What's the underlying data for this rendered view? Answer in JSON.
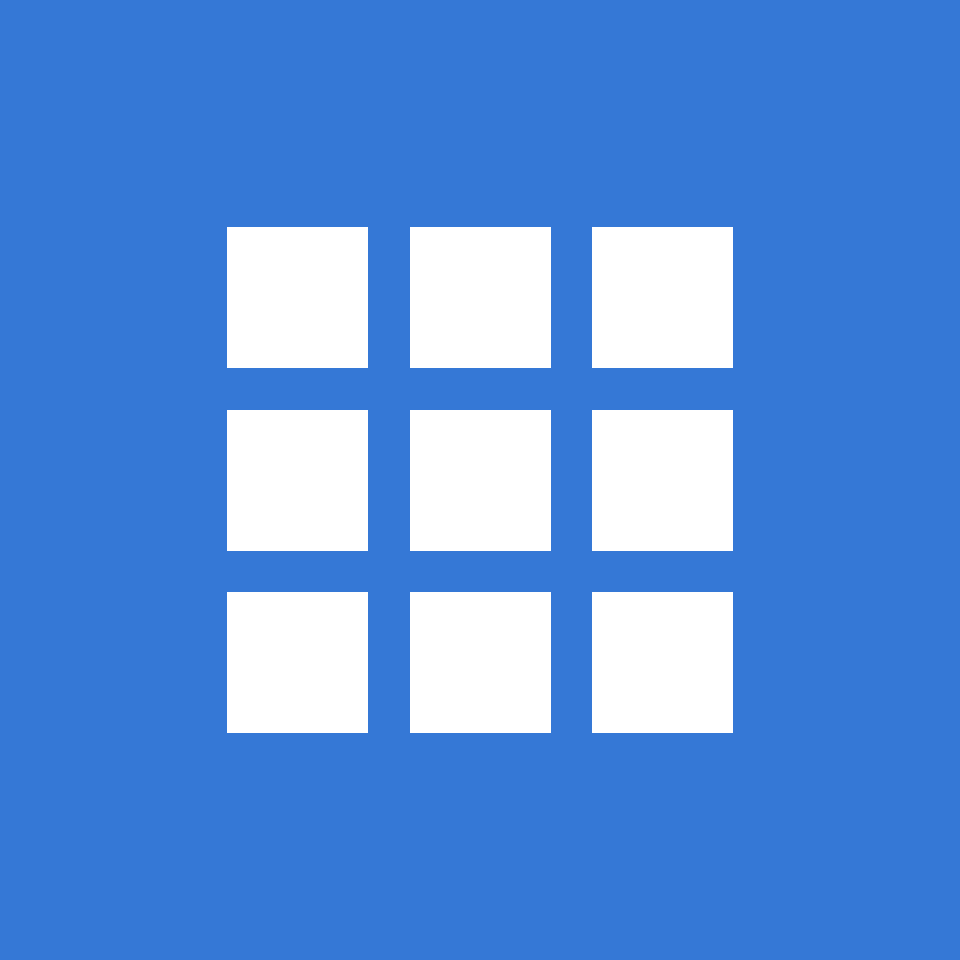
{
  "icon": {
    "name": "grid-icon",
    "rows": 3,
    "columns": 3
  },
  "colors": {
    "background": "#3578d6",
    "tile": "#ffffff"
  }
}
